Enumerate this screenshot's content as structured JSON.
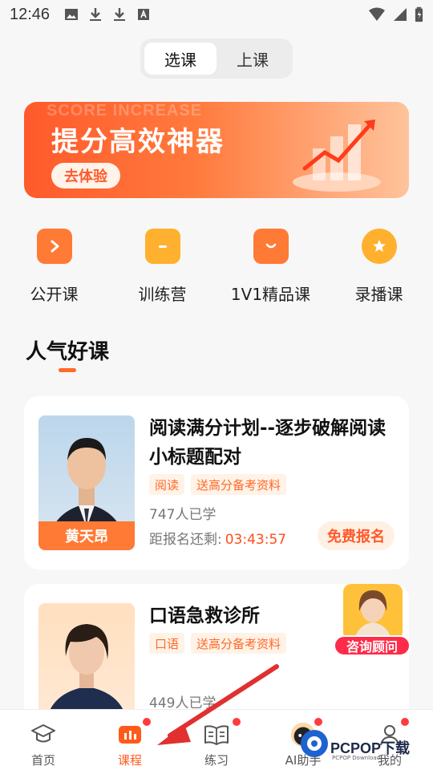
{
  "status": {
    "time": "12:46"
  },
  "segment": {
    "options": [
      "选课",
      "上课"
    ],
    "active": 0
  },
  "banner": {
    "ghost": "SCORE INCREASE",
    "title": "提分高效神器",
    "cta": "去体验"
  },
  "categories": [
    {
      "label": "公开课",
      "icon": "play-icon",
      "color": "#ff7a35"
    },
    {
      "label": "训练营",
      "icon": "clipboard-icon",
      "color": "#ffb02e"
    },
    {
      "label": "1V1精品课",
      "icon": "chat-icon",
      "color": "#ff7a35"
    },
    {
      "label": "录播课",
      "icon": "star-badge-icon",
      "color": "#ffb02e"
    }
  ],
  "section": {
    "title": "人气好课"
  },
  "courses": [
    {
      "title": "阅读满分计划--逐步破解阅读小标题配对",
      "teacher": "黄天昂",
      "tags": [
        "阅读",
        "送高分备考资料"
      ],
      "learners": "747人已学",
      "countdown_label": "距报名还剩:",
      "countdown": "03:43:57",
      "enroll": "免费报名"
    },
    {
      "title": "口语急救诊所",
      "tags": [
        "口语",
        "送高分备考资料"
      ],
      "learners": "449人已学"
    }
  ],
  "advisor": {
    "label": "咨询顾问"
  },
  "tabs": [
    {
      "label": "首页",
      "icon": "home-icon"
    },
    {
      "label": "课程",
      "icon": "course-icon"
    },
    {
      "label": "练习",
      "icon": "book-icon"
    },
    {
      "label": "AI助手",
      "icon": "ai-icon"
    },
    {
      "label": "我的",
      "icon": "user-icon"
    }
  ],
  "watermark": {
    "text": "PCPOP下载",
    "sub": "PCPOP Download"
  },
  "colors": {
    "accent": "#ff5a1a",
    "badge": "#ff3b3b"
  }
}
